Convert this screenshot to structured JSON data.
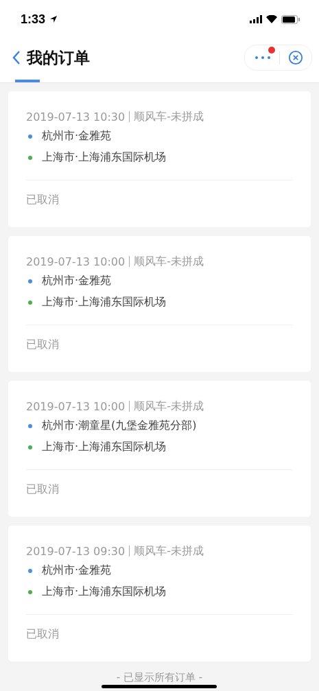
{
  "status_bar": {
    "time": "1:33"
  },
  "header": {
    "title": "我的订单",
    "tab_indicator": true,
    "notification_dot": true
  },
  "orders": [
    {
      "datetime": "2019-07-13 10:30",
      "type": "顺风车-未拼成",
      "stops": [
        {
          "text": "杭州市·金雅苑",
          "color": "#4a90e2"
        },
        {
          "text": "上海市·上海浦东国际机场",
          "color": "#4caf50"
        }
      ],
      "status": "已取消"
    },
    {
      "datetime": "2019-07-13 10:00",
      "type": "顺风车-未拼成",
      "stops": [
        {
          "text": "杭州市·金雅苑",
          "color": "#4a90e2"
        },
        {
          "text": "上海市·上海浦东国际机场",
          "color": "#4caf50"
        }
      ],
      "status": "已取消"
    },
    {
      "datetime": "2019-07-13 10:00",
      "type": "顺风车-未拼成",
      "stops": [
        {
          "text": "杭州市·潮童星(九堡金雅苑分部)",
          "color": "#4a90e2"
        },
        {
          "text": "上海市·上海浦东国际机场",
          "color": "#4caf50"
        }
      ],
      "status": "已取消"
    },
    {
      "datetime": "2019-07-13 09:30",
      "type": "顺风车-未拼成",
      "stops": [
        {
          "text": "杭州市·金雅苑",
          "color": "#4a90e2"
        },
        {
          "text": "上海市·上海浦东国际机场",
          "color": "#4caf50"
        }
      ],
      "status": "已取消"
    }
  ],
  "footer": "- 已显示所有订单 -"
}
